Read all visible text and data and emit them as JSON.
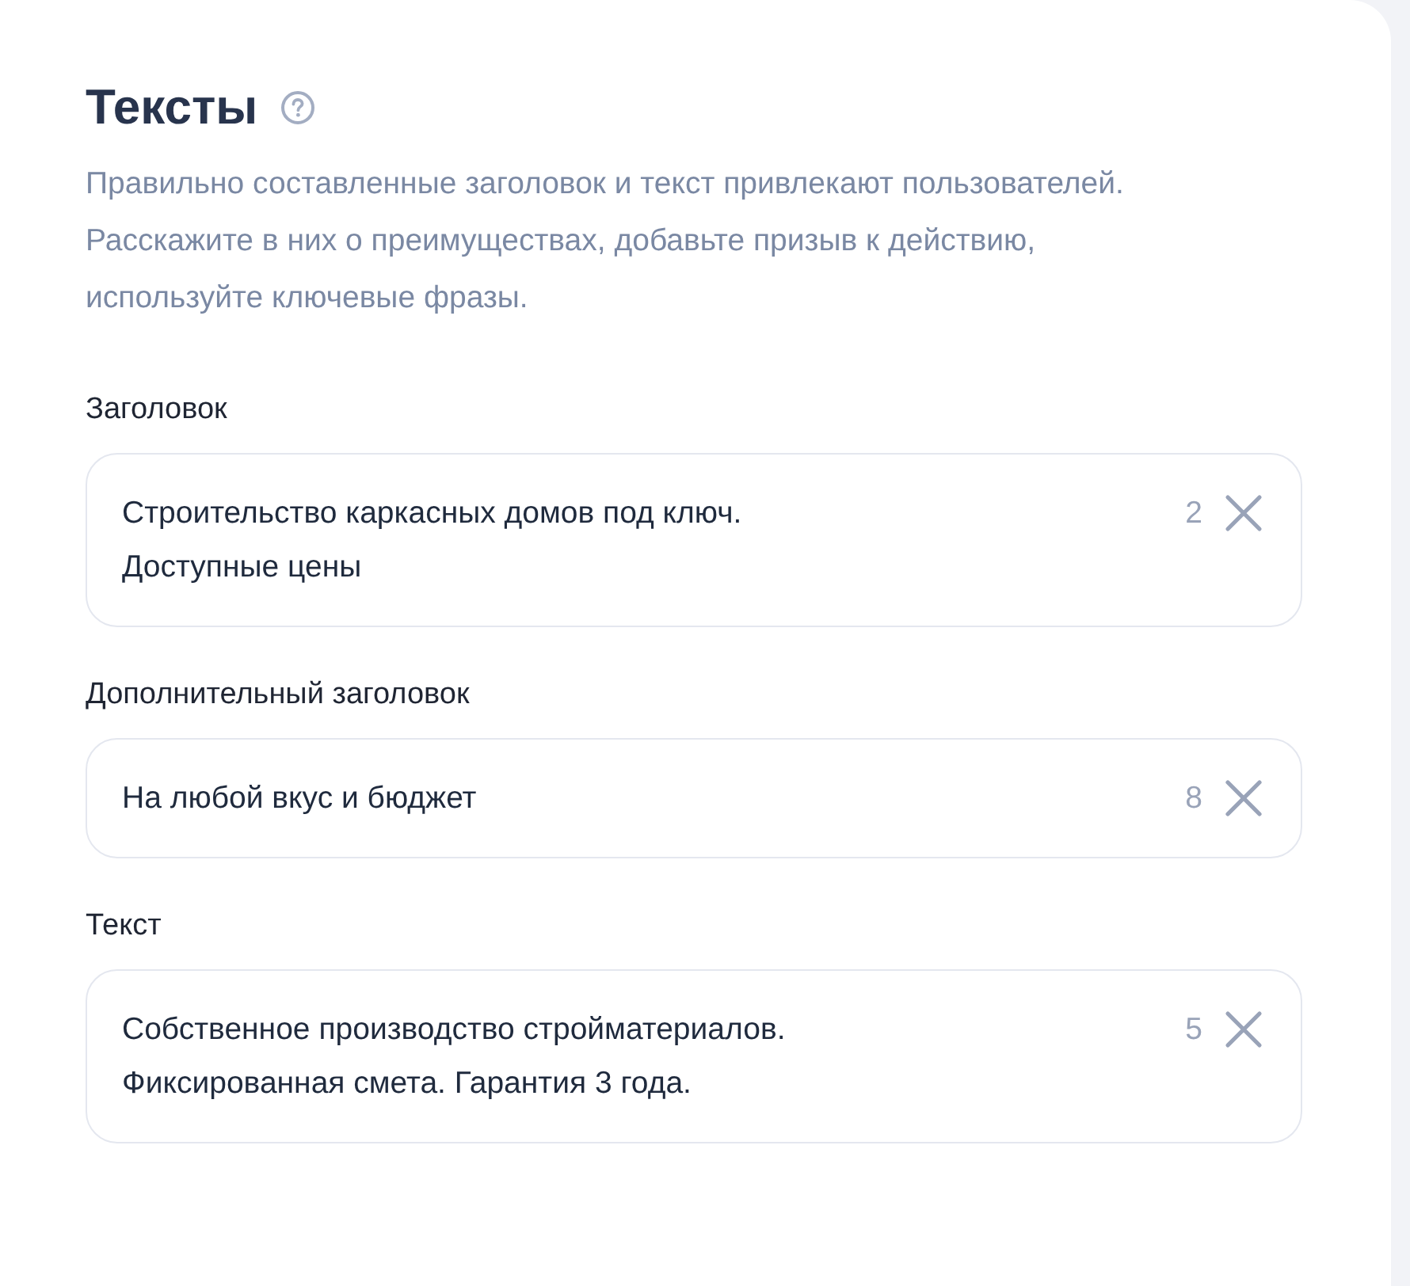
{
  "section": {
    "title": "Тексты",
    "description": "Правильно составленные заголовок и текст привлекают пользователей. Расскажите в них о преимуществах, добавьте призыв к действию, используйте ключевые фразы."
  },
  "fields": [
    {
      "label": "Заголовок",
      "lines": [
        "Строительство каркасных домов под ключ.",
        "Доступные цены"
      ],
      "counter": "2"
    },
    {
      "label": "Дополнительный заголовок",
      "lines": [
        "На любой вкус и бюджет"
      ],
      "counter": "8"
    },
    {
      "label": "Текст",
      "lines": [
        "Собственное производство стройматериалов.",
        "Фиксированная смета. Гарантия 3 года."
      ],
      "counter": "5"
    }
  ]
}
